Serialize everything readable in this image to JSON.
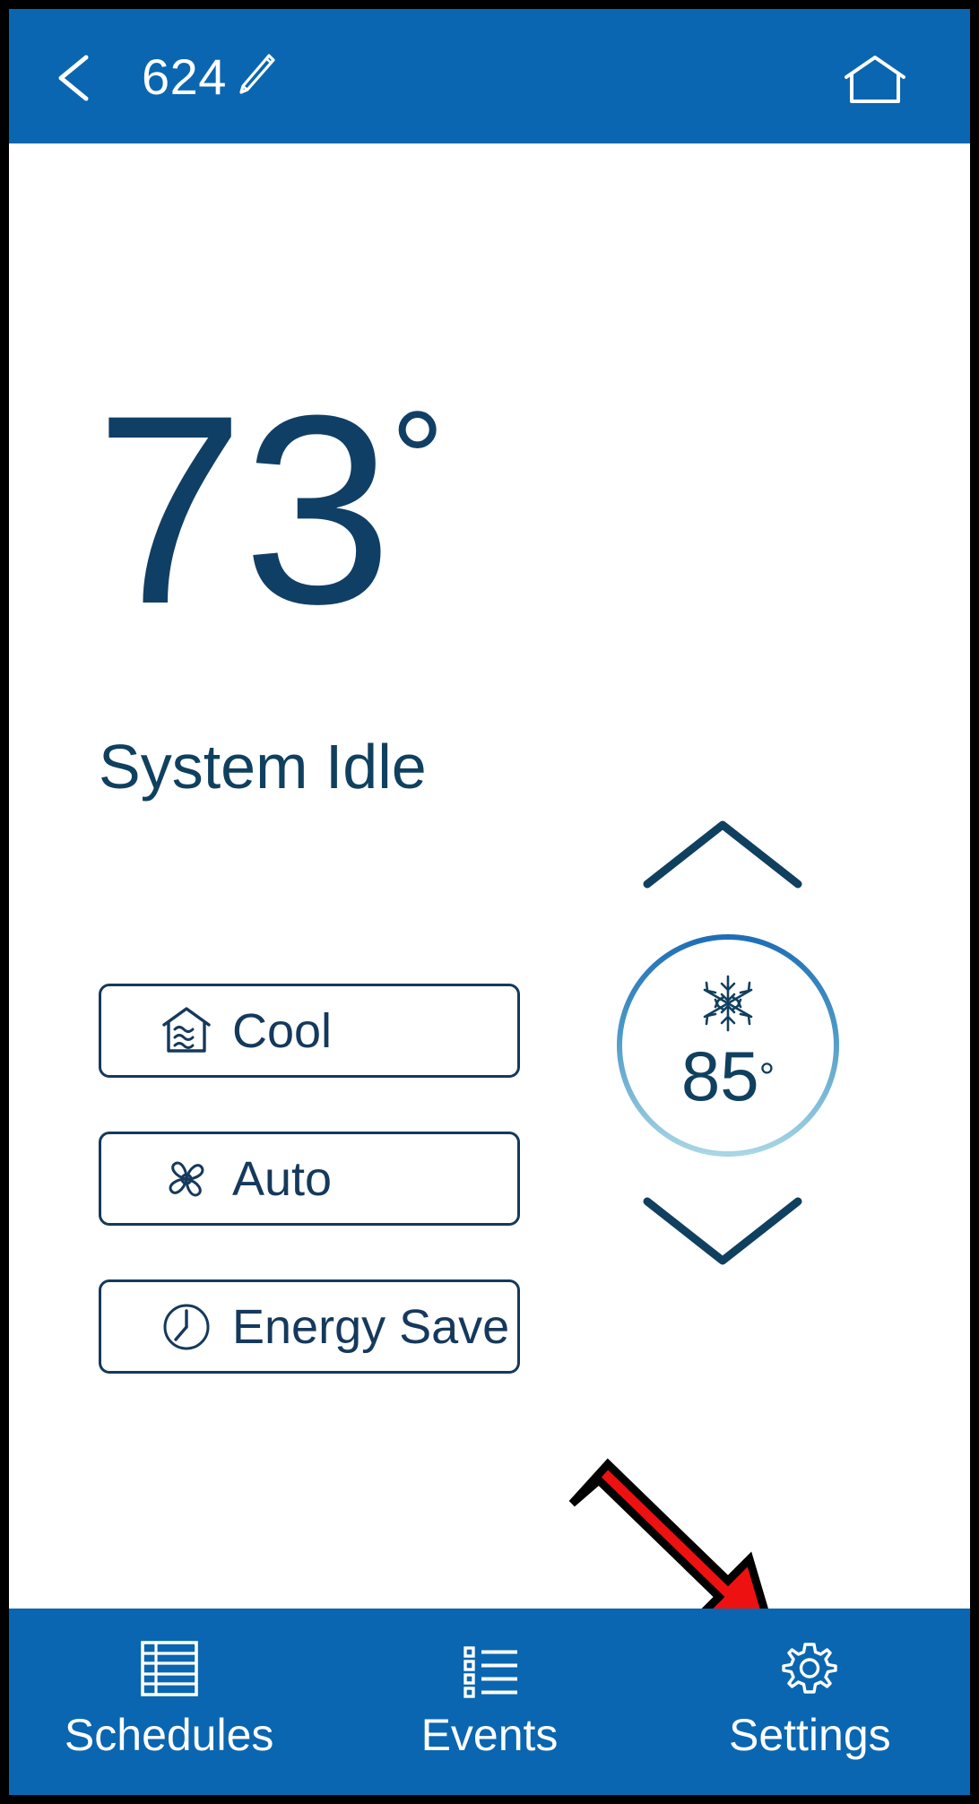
{
  "header": {
    "back_icon": "back-chevron-icon",
    "title": "624",
    "edit_icon": "pencil-edit-icon",
    "home_icon": "home-icon"
  },
  "main": {
    "current_temperature": "73",
    "current_temperature_unit": "°",
    "system_status": "System Idle",
    "modes": [
      {
        "label": "Cool",
        "icon": "house-cool-icon"
      },
      {
        "label": "Auto",
        "icon": "fan-icon"
      },
      {
        "label": "Energy Save",
        "icon": "clock-icon"
      }
    ],
    "setpoint": {
      "up_icon": "chevron-up-icon",
      "down_icon": "chevron-down-icon",
      "mode_icon": "snowflake-icon",
      "value": "85",
      "unit": "°"
    }
  },
  "bottom_nav": [
    {
      "label": "Schedules",
      "icon": "table-grid-icon"
    },
    {
      "label": "Events",
      "icon": "bulleted-list-icon"
    },
    {
      "label": "Settings",
      "icon": "gear-icon"
    }
  ],
  "annotation": {
    "type": "red-arrow",
    "points_to": "Settings"
  },
  "colors": {
    "brand_blue": "#0a66b0",
    "navy": "#10405f",
    "outline_navy": "#15395c",
    "ring_top": "#1f6eb5",
    "ring_bottom": "#a8d6e5",
    "annotation_red": "#ee1111",
    "frame_black": "#000000",
    "white": "#ffffff"
  }
}
